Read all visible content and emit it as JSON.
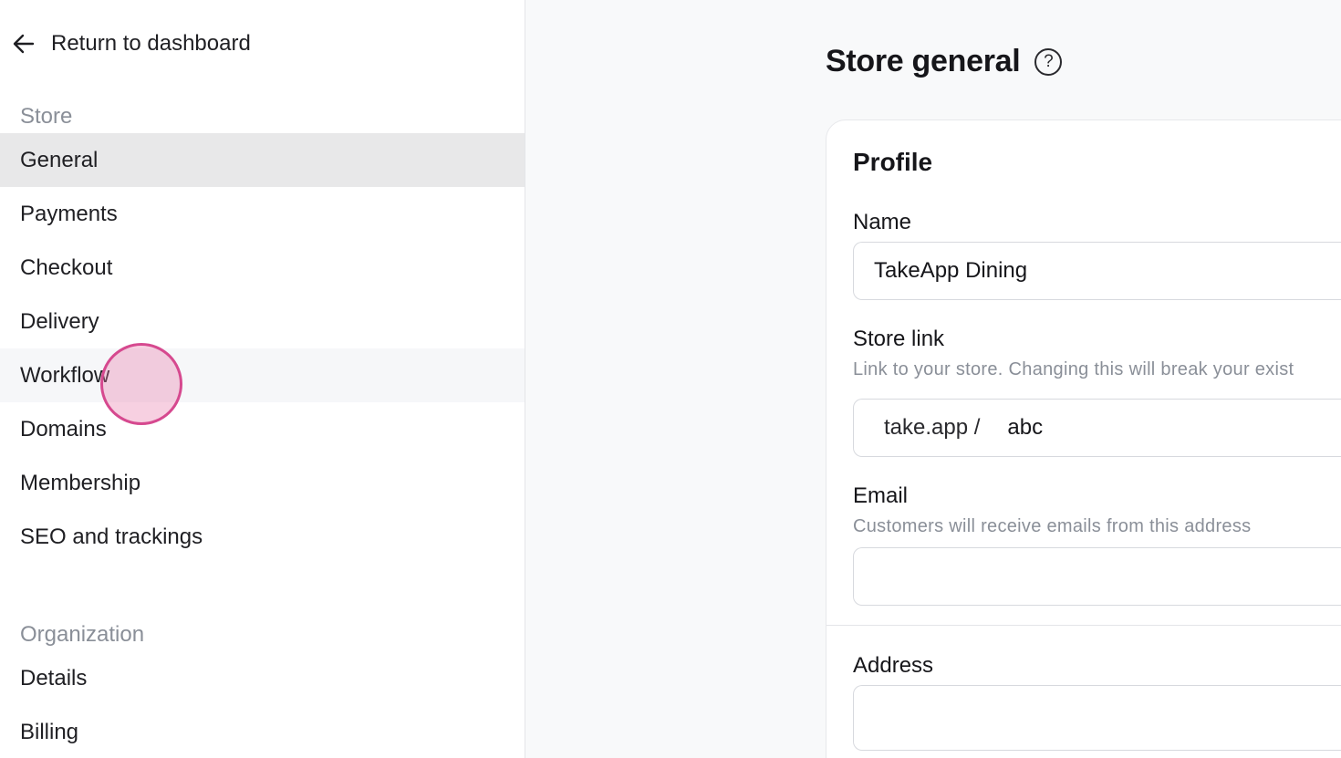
{
  "sidebar": {
    "back_label": "Return to dashboard",
    "store_section": "Store",
    "store_items": [
      {
        "label": "General"
      },
      {
        "label": "Payments"
      },
      {
        "label": "Checkout"
      },
      {
        "label": "Delivery"
      },
      {
        "label": "Workflow"
      },
      {
        "label": "Domains"
      },
      {
        "label": "Membership"
      },
      {
        "label": "SEO and trackings"
      }
    ],
    "org_section": "Organization",
    "org_items": [
      {
        "label": "Details"
      },
      {
        "label": "Billing"
      }
    ]
  },
  "main": {
    "title": "Store general",
    "help_icon": "?",
    "profile": {
      "title": "Profile",
      "name_label": "Name",
      "name_value": "TakeApp Dining",
      "store_link_label": "Store link",
      "store_link_help": "Link to your store. Changing this will break your exist",
      "store_link_prefix": "take.app /",
      "store_link_value": "abc",
      "email_label": "Email",
      "email_help": "Customers will receive emails from this address",
      "email_value": "",
      "address_label": "Address",
      "address_value": ""
    }
  },
  "colors": {
    "active_bg": "#e8e8e9",
    "hover_bg": "#f6f7f9",
    "muted_text": "#8a8f98",
    "click_marker": "#d6498f"
  }
}
